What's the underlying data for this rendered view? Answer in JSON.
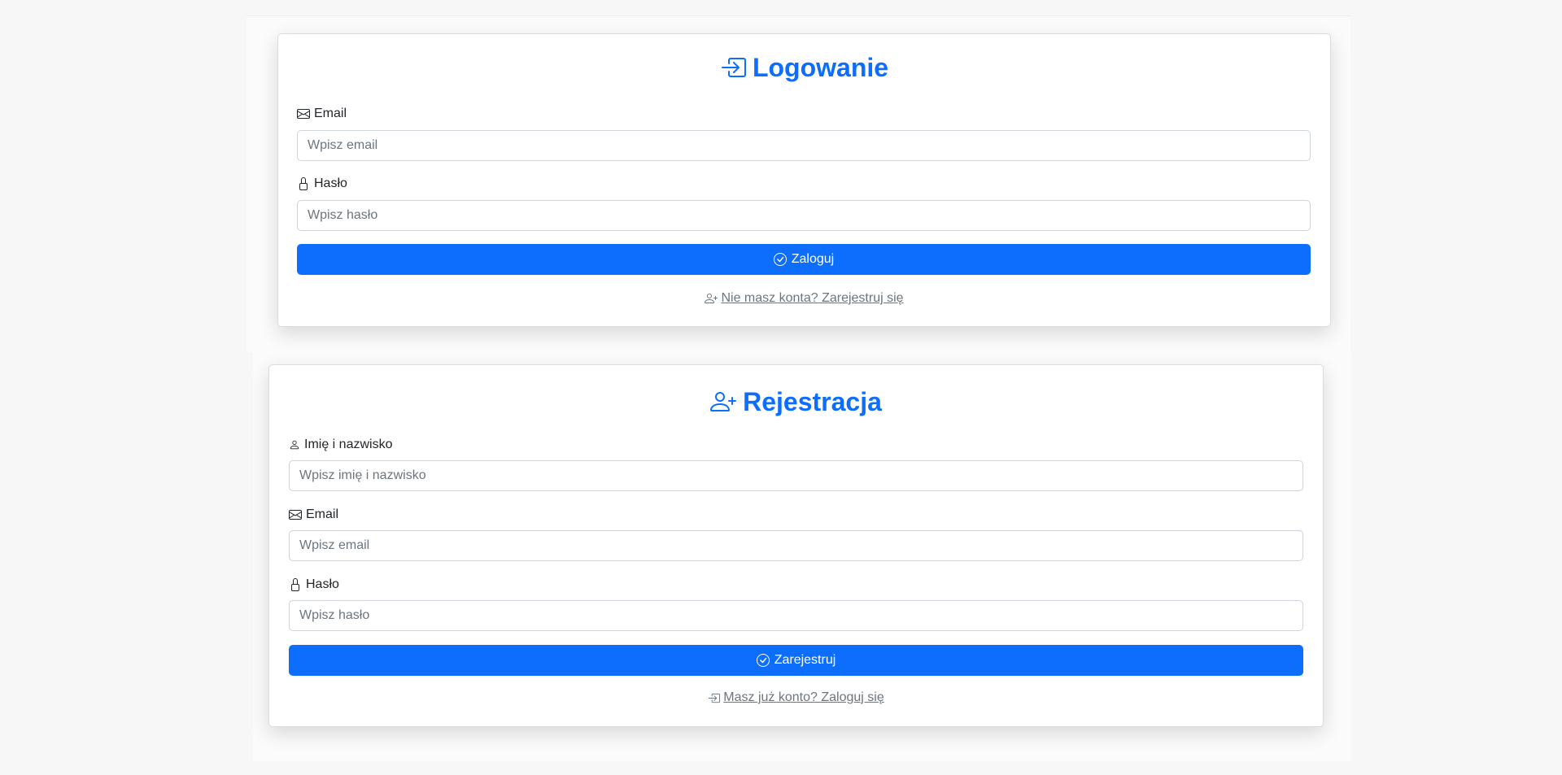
{
  "login": {
    "title": "Logowanie",
    "title_icon": "box-arrow-in-right-icon",
    "email": {
      "label": "Email",
      "icon": "envelope-icon",
      "placeholder": "Wpisz email",
      "value": ""
    },
    "password": {
      "label": "Hasło",
      "icon": "lock-icon",
      "placeholder": "Wpisz hasło",
      "value": ""
    },
    "submit": {
      "label": "Zaloguj",
      "icon": "check-circle-icon"
    },
    "switch_link": {
      "label": " Nie masz konta? Zarejestruj się",
      "icon": "person-plus-icon"
    }
  },
  "register": {
    "title": "Rejestracja",
    "title_icon": "person-plus-icon",
    "fullname": {
      "label": "Imię i nazwisko",
      "icon": "person-icon",
      "placeholder": "Wpisz imię i nazwisko",
      "value": ""
    },
    "email": {
      "label": "Email",
      "icon": "envelope-icon",
      "placeholder": "Wpisz email",
      "value": ""
    },
    "password": {
      "label": "Hasło",
      "icon": "lock-icon",
      "placeholder": "Wpisz hasło",
      "value": ""
    },
    "submit": {
      "label": "Zarejestruj",
      "icon": "check-circle-icon"
    },
    "switch_link": {
      "label": " Masz już konto? Zaloguj się",
      "icon": "box-arrow-in-right-icon"
    }
  },
  "colors": {
    "primary": "#0d6efd",
    "background": "#f7f7f7",
    "muted_text": "#6c757d",
    "input_border": "#ced4da"
  }
}
